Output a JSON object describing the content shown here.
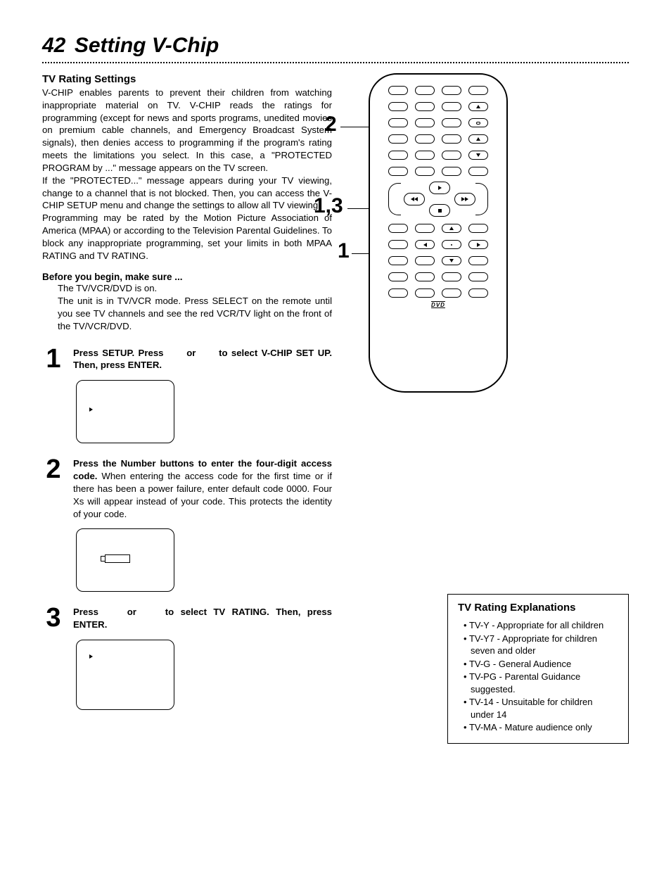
{
  "header": {
    "page_number": "42",
    "title": "Setting V-Chip"
  },
  "section": {
    "heading": "TV Rating Settings",
    "para1": "V-CHIP enables parents to prevent their children from watching inappropriate material on TV. V-CHIP reads the ratings for programming (except for news and sports programs, unedited movies on premium cable channels, and Emergency Broadcast System signals), then denies access to programming if the program's rating meets the limitations you select. In this case, a \"PROTECTED PROGRAM by ...\" message appears on the TV screen.",
    "para2": "If the \"PROTECTED...\" message appears during your TV viewing, change to a channel that is not blocked. Then, you can access the V-CHIP SETUP menu and change the settings to allow all TV viewing.",
    "para3": "Programming may be rated by the Motion Picture Association of America (MPAA) or according to the Television Parental Guidelines. To block any inappropriate programming, set your limits in both MPAA RATING and TV RATING."
  },
  "before": {
    "heading": "Before you begin, make sure ...",
    "line1": "The TV/VCR/DVD is on.",
    "line2": "The unit is in TV/VCR mode. Press SELECT on the remote until you see TV channels and see the red VCR/TV light on the front of the TV/VCR/DVD."
  },
  "steps": {
    "s1": {
      "num": "1",
      "bold1": "Press SETUP. Press ",
      "gap1": " or ",
      "bold2": " to select V-CHIP SET UP. Then, press ENTER."
    },
    "s2": {
      "num": "2",
      "bold": "Press the Number buttons to enter the four-digit access code.",
      "rest": " When entering the access code for the first time or if there has been a power failure, enter default code 0000. Four Xs will appear instead of your code. This protects the identity of your code."
    },
    "s3": {
      "num": "3",
      "bold1": "Press ",
      "gap1": " or ",
      "bold2": " to select TV RATING. Then, press ENTER."
    }
  },
  "callouts": {
    "c2": "2",
    "c13": "1,3",
    "c1": "1"
  },
  "remote": {
    "dvd": "DVD"
  },
  "sidebar": {
    "heading": "TV Rating Explanations",
    "items": [
      "TV-Y - Appropriate for all children",
      "TV-Y7 - Appropriate for children seven and older",
      "TV-G - General Audience",
      "TV-PG - Parental Guidance suggested.",
      "TV-14 - Unsuitable for children under 14",
      "TV-MA - Mature audience only"
    ]
  }
}
